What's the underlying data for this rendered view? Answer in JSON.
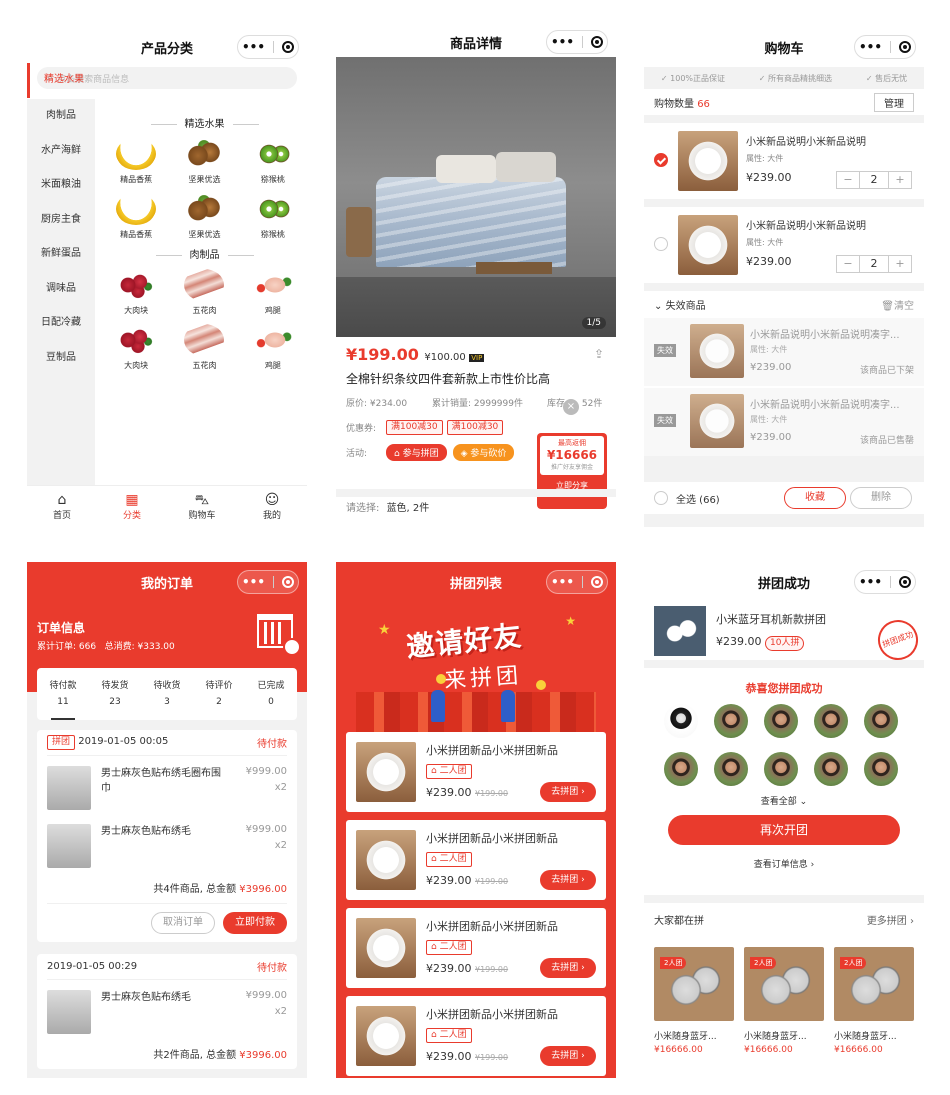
{
  "screens": {
    "category": {
      "title": "产品分类",
      "search_placeholder": "点击搜索商品信息",
      "sidebar": [
        "精选水果",
        "肉制品",
        "水产海鲜",
        "米面粮油",
        "厨房主食",
        "新鲜蛋品",
        "调味品",
        "日配冷藏",
        "豆制品"
      ],
      "sections": [
        {
          "title": "精选水果",
          "items": [
            {
              "name": "精品香蕉",
              "icon": "banana"
            },
            {
              "name": "坚果优选",
              "icon": "hazelnut"
            },
            {
              "name": "猕猴桃",
              "icon": "kiwi"
            },
            {
              "name": "精品香蕉",
              "icon": "banana"
            },
            {
              "name": "坚果优选",
              "icon": "hazelnut"
            },
            {
              "name": "猕猴桃",
              "icon": "kiwi"
            }
          ]
        },
        {
          "title": "肉制品",
          "items": [
            {
              "name": "大肉块",
              "icon": "meat-cubes"
            },
            {
              "name": "五花肉",
              "icon": "pork-belly"
            },
            {
              "name": "鸡腿",
              "icon": "chicken-leg"
            },
            {
              "name": "大肉块",
              "icon": "meat-cubes"
            },
            {
              "name": "五花肉",
              "icon": "pork-belly"
            },
            {
              "name": "鸡腿",
              "icon": "chicken-leg"
            }
          ]
        }
      ],
      "tabbar": [
        "首页",
        "分类",
        "购物车",
        "我的"
      ]
    },
    "detail": {
      "title": "商品详情",
      "image_index": "1/5",
      "price": "¥199.00",
      "old_price": "¥100.00",
      "vip": "VIP",
      "name": "全棉针织条纹四件套新款上市性价比高",
      "orig_price": "原价: ¥234.00",
      "sales": "累计销量: 2999999件",
      "stock_prefix": "库存",
      "stock_suffix": "52件",
      "coupon_label": "优惠券:",
      "coupons": [
        "满100减30",
        "满100减30"
      ],
      "activity_label": "活动:",
      "activities": [
        "参与拼团",
        "参与砍价"
      ],
      "share": {
        "title": "最高返佣",
        "amount": "¥16666",
        "note": "推广好友享佣金",
        "button": "立即分享"
      },
      "select_label": "请选择:",
      "select_value": "蓝色, 2件"
    },
    "cart": {
      "title": "购物车",
      "guarantees": [
        "100%正品保证",
        "所有商品精挑细选",
        "售后无忧"
      ],
      "count_label": "购物数量",
      "count": "66",
      "manage": "管理",
      "items": [
        {
          "name": "小米新品说明小米新品说明",
          "attr": "属性: 大件",
          "price": "¥239.00",
          "qty": "2",
          "checked": true
        },
        {
          "name": "小米新品说明小米新品说明",
          "attr": "属性: 大件",
          "price": "¥239.00",
          "qty": "2",
          "checked": false
        }
      ],
      "invalid_title": "失效商品",
      "clear": "清空",
      "invalid_tag": "失效",
      "invalid_items": [
        {
          "name": "小米新品说明小米新品说明凑字...",
          "attr": "属性: 大件",
          "price": "¥239.00",
          "status": "该商品已下架"
        },
        {
          "name": "小米新品说明小米新品说明凑字...",
          "attr": "属性: 大件",
          "price": "¥239.00",
          "status": "该商品已售罄"
        }
      ],
      "select_all": "全选 (66)",
      "collect": "收藏",
      "delete": "删除"
    },
    "orders": {
      "title": "我的订单",
      "info_title": "订单信息",
      "stats": "累计订单: 666   总消费: ¥333.00",
      "tabs": [
        {
          "label": "待付款",
          "count": "11"
        },
        {
          "label": "待发货",
          "count": "23"
        },
        {
          "label": "待收货",
          "count": "3"
        },
        {
          "label": "待评价",
          "count": "2"
        },
        {
          "label": "已完成",
          "count": "0"
        }
      ],
      "cards": [
        {
          "tag": "拼团",
          "date": "2019-01-05 00:05",
          "status": "待付款",
          "items": [
            {
              "name": "男士麻灰色贴布绣毛圈布围巾",
              "price": "¥999.00",
              "qty": "x2"
            },
            {
              "name": "男士麻灰色贴布绣毛",
              "price": "¥999.00",
              "qty": "x2"
            }
          ],
          "summary": "共4件商品, 总金额",
          "total": "¥3996.00",
          "cancel": "取消订单",
          "pay": "立即付款"
        },
        {
          "tag": "",
          "date": "2019-01-05 00:29",
          "status": "待付款",
          "items": [
            {
              "name": "男士麻灰色贴布绣毛",
              "price": "¥999.00",
              "qty": "x2"
            }
          ],
          "summary": "共2件商品, 总金额",
          "total": "¥3996.00"
        }
      ]
    },
    "group_list": {
      "title": "拼团列表",
      "banner_line1": "邀请好友",
      "banner_line2": "来拼团",
      "items": [
        {
          "name": "小米拼团新品小米拼团新品",
          "tag": "二人团",
          "price": "¥239.00",
          "old": "¥199.00",
          "button": "去拼团"
        },
        {
          "name": "小米拼团新品小米拼团新品",
          "tag": "二人团",
          "price": "¥239.00",
          "old": "¥199.00",
          "button": "去拼团"
        },
        {
          "name": "小米拼团新品小米拼团新品",
          "tag": "二人团",
          "price": "¥239.00",
          "old": "¥199.00",
          "button": "去拼团"
        },
        {
          "name": "小米拼团新品小米拼团新品",
          "tag": "二人团",
          "price": "¥239.00",
          "old": "¥199.00",
          "button": "去拼团"
        }
      ]
    },
    "group_success": {
      "title": "拼团成功",
      "product_name": "小米蓝牙耳机新款拼团",
      "price": "¥239.00",
      "tag": "10人拼",
      "stamp": "拼团成功",
      "congrats": "恭喜您拼团成功",
      "view_all": "查看全部",
      "reopen": "再次开团",
      "view_order": "查看订单信息",
      "everyone": "大家都在拼",
      "more": "更多拼团",
      "recommend": [
        {
          "tag": "2人团",
          "name": "小米随身蓝牙...",
          "price": "¥16666.00"
        },
        {
          "tag": "2人团",
          "name": "小米随身蓝牙...",
          "price": "¥16666.00"
        },
        {
          "tag": "2人团",
          "name": "小米随身蓝牙...",
          "price": "¥16666.00"
        }
      ]
    }
  },
  "colors": {
    "accent": "#e93b2d",
    "text": "#333333",
    "muted": "#999999",
    "bg": "#f2f2f2"
  }
}
